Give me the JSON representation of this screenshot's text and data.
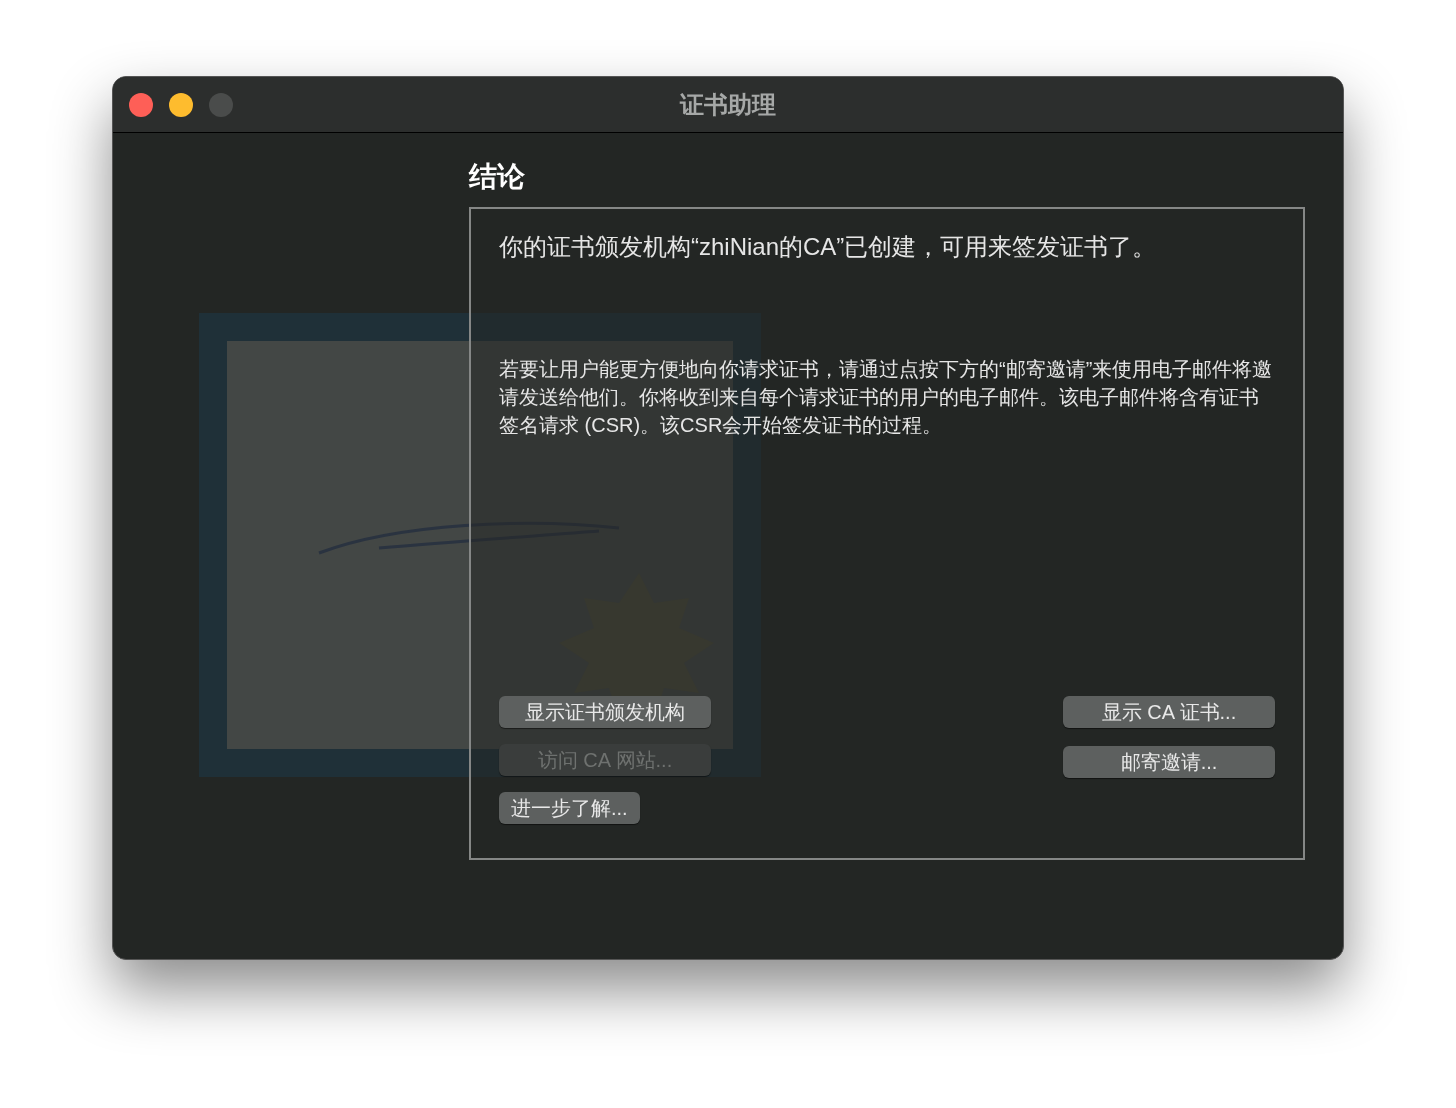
{
  "window": {
    "title": "证书助理",
    "zoom_enabled": false
  },
  "heading": "结论",
  "message": "你的证书颁发机构“zhiNian的CA”已创建，可用来签发证书了。",
  "description": "若要让用户能更方便地向你请求证书，请通过点按下方的“邮寄邀请”来使用电子邮件将邀请发送给他们。你将收到来自每个请求证书的用户的电子邮件。该电子邮件将含有证书签名请求 (CSR)。该CSR会开始签发证书的过程。",
  "left_buttons": [
    {
      "label": "显示证书颁发机构",
      "disabled": false
    },
    {
      "label": "访问 CA 网站...",
      "disabled": true
    },
    {
      "label": "进一步了解...",
      "disabled": false
    }
  ],
  "right_buttons": [
    {
      "label": "显示 CA 证书...",
      "disabled": false
    },
    {
      "label": "邮寄邀请...",
      "disabled": false
    }
  ]
}
